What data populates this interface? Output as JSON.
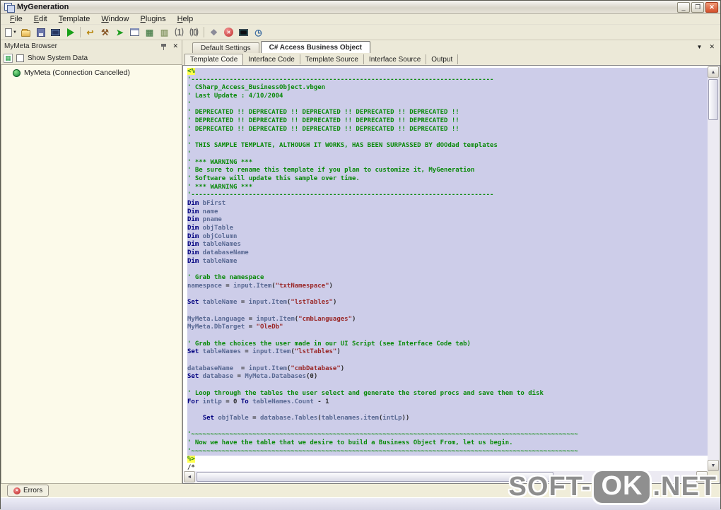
{
  "window": {
    "title": "MyGeneration"
  },
  "title_buttons": {
    "minimize": "_",
    "restore": "❐",
    "close": "✕"
  },
  "menu_bar": {
    "items": [
      "File",
      "Edit",
      "Template",
      "Window",
      "Plugins",
      "Help"
    ]
  },
  "toolbar": {
    "icons": [
      {
        "name": "new-file-icon",
        "kind": "page",
        "dropdown": true
      },
      {
        "name": "open-folder-icon",
        "kind": "folder"
      },
      {
        "name": "save-icon",
        "kind": "floppy"
      },
      {
        "name": "console-icon",
        "kind": "console"
      },
      {
        "name": "run-template-icon",
        "kind": "play"
      },
      {
        "name": "sep1",
        "kind": "sep"
      },
      {
        "name": "revert-icon",
        "kind": "glyph",
        "glyph": "↩",
        "color": "#b8860b"
      },
      {
        "name": "build-tools-icon",
        "kind": "glyph",
        "glyph": "⚒",
        "color": "#8a5a2a"
      },
      {
        "name": "execute-script-icon",
        "kind": "glyph",
        "glyph": "➤",
        "color": "#1f9e1f"
      },
      {
        "name": "form-designer-icon",
        "kind": "form"
      },
      {
        "name": "tile-horizontal-icon",
        "kind": "glyph",
        "glyph": "▦",
        "color": "#5a8a5a"
      },
      {
        "name": "tile-vertical-icon",
        "kind": "glyph",
        "glyph": "▥",
        "color": "#8a9a6a"
      },
      {
        "name": "info-1-icon",
        "kind": "glyph",
        "glyph": "⑴",
        "color": "#666"
      },
      {
        "name": "info-0-icon",
        "kind": "glyph",
        "glyph": "⑽",
        "color": "#666"
      },
      {
        "name": "sep2",
        "kind": "sep"
      },
      {
        "name": "plugin-icon",
        "kind": "glyph",
        "glyph": "❖",
        "color": "#8a8a98"
      },
      {
        "name": "stop-icon",
        "kind": "circle-x",
        "glyph": "✕"
      },
      {
        "name": "monitor-icon",
        "kind": "monitor-dark"
      },
      {
        "name": "clock-icon",
        "kind": "glyph",
        "glyph": "◷",
        "color": "#3a6aa0"
      }
    ]
  },
  "sidebar": {
    "title": "MyMeta Browser",
    "show_system_data_label": "Show System Data",
    "tree": [
      {
        "label": "MyMeta (Connection Cancelled)"
      }
    ]
  },
  "document_tabs": [
    {
      "label": "Default Settings",
      "active": false
    },
    {
      "label": "C# Access Business Object",
      "active": true
    }
  ],
  "editor_tabs": [
    {
      "label": "Template Code",
      "active": true
    },
    {
      "label": "Interface Code",
      "active": false
    },
    {
      "label": "Template Source",
      "active": false
    },
    {
      "label": "Interface Source",
      "active": false
    },
    {
      "label": "Output",
      "active": false
    }
  ],
  "errors_panel": {
    "label": "Errors"
  },
  "watermark": {
    "left": "SOFT-",
    "ok": "OK",
    "right": ".NET"
  },
  "colors": {
    "selection_bg": "#cdcde9",
    "comment": "#0a8a0a",
    "keyword": "#00007f",
    "string": "#9a2828",
    "script_tag_bg": "#ffff4e",
    "close_button": "#d4502b",
    "error_red": "#bb2a2a"
  },
  "editor": {
    "selected_count": 47,
    "lines": [
      [
        [
          "tag",
          "<%"
        ]
      ],
      [
        [
          "cm",
          "'-------------------------------------------------------------------------------"
        ]
      ],
      [
        [
          "cm",
          "' CSharp_Access_BusinessObject.vbgen"
        ]
      ],
      [
        [
          "cm",
          "' Last Update : 4/10/2004"
        ]
      ],
      [
        [
          "cm",
          "'"
        ]
      ],
      [
        [
          "cm",
          "' DEPRECATED !! DEPRECATED !! DEPRECATED !! DEPRECATED !! DEPRECATED !!"
        ]
      ],
      [
        [
          "cm",
          "' DEPRECATED !! DEPRECATED !! DEPRECATED !! DEPRECATED !! DEPRECATED !!"
        ]
      ],
      [
        [
          "cm",
          "' DEPRECATED !! DEPRECATED !! DEPRECATED !! DEPRECATED !! DEPRECATED !!"
        ]
      ],
      [
        [
          "cm",
          "'"
        ]
      ],
      [
        [
          "cm",
          "' THIS SAMPLE TEMPLATE, ALTHOUGH IT WORKS, HAS BEEN SURPASSED BY dOOdad templates"
        ]
      ],
      [
        [
          "cm",
          "'"
        ]
      ],
      [
        [
          "cm",
          "' *** WARNING ***"
        ]
      ],
      [
        [
          "cm",
          "' Be sure to rename this template if you plan to customize it, MyGeneration"
        ]
      ],
      [
        [
          "cm",
          "' Software will update this sample over time."
        ]
      ],
      [
        [
          "cm",
          "' *** WARNING ***"
        ]
      ],
      [
        [
          "cm",
          "'-------------------------------------------------------------------------------"
        ]
      ],
      [
        [
          "kw",
          "Dim"
        ],
        [
          "idn",
          " bFirst"
        ]
      ],
      [
        [
          "kw",
          "Dim"
        ],
        [
          "idn",
          " name"
        ]
      ],
      [
        [
          "kw",
          "Dim"
        ],
        [
          "idn",
          " pname"
        ]
      ],
      [
        [
          "kw",
          "Dim"
        ],
        [
          "idn",
          " objTable"
        ]
      ],
      [
        [
          "kw",
          "Dim"
        ],
        [
          "idn",
          " objColumn"
        ]
      ],
      [
        [
          "kw",
          "Dim"
        ],
        [
          "idn",
          " tableNames"
        ]
      ],
      [
        [
          "kw",
          "Dim"
        ],
        [
          "idn",
          " databaseName"
        ]
      ],
      [
        [
          "kw",
          "Dim"
        ],
        [
          "idn",
          " tableName"
        ]
      ],
      [],
      [
        [
          "cm",
          "' Grab the namespace"
        ]
      ],
      [
        [
          "idn",
          "namespace"
        ],
        [
          "pl",
          " = "
        ],
        [
          "idn",
          "input.Item"
        ],
        [
          "pl",
          "("
        ],
        [
          "str",
          "\"txtNamespace\""
        ],
        [
          "pl",
          ")"
        ]
      ],
      [],
      [
        [
          "kw",
          "Set"
        ],
        [
          "idn",
          " tableName"
        ],
        [
          "pl",
          " = "
        ],
        [
          "idn",
          "input.Item"
        ],
        [
          "pl",
          "("
        ],
        [
          "str",
          "\"lstTables\""
        ],
        [
          "pl",
          ")"
        ]
      ],
      [],
      [
        [
          "idn",
          "MyMeta.Language"
        ],
        [
          "pl",
          " = "
        ],
        [
          "idn",
          "input.Item"
        ],
        [
          "pl",
          "("
        ],
        [
          "str",
          "\"cmbLanguages\""
        ],
        [
          "pl",
          ")"
        ]
      ],
      [
        [
          "idn",
          "MyMeta.DbTarget"
        ],
        [
          "pl",
          " = "
        ],
        [
          "str",
          "\"OleDb\""
        ]
      ],
      [],
      [
        [
          "cm",
          "' Grab the choices the user made in our UI Script (see Interface Code tab)"
        ]
      ],
      [
        [
          "kw",
          "Set"
        ],
        [
          "idn",
          " tableNames"
        ],
        [
          "pl",
          " = "
        ],
        [
          "idn",
          "input.Item"
        ],
        [
          "pl",
          "("
        ],
        [
          "str",
          "\"lstTables\""
        ],
        [
          "pl",
          ")"
        ]
      ],
      [],
      [
        [
          "idn",
          "databaseName"
        ],
        [
          "pl",
          "  = "
        ],
        [
          "idn",
          "input.Item"
        ],
        [
          "pl",
          "("
        ],
        [
          "str",
          "\"cmbDatabase\""
        ],
        [
          "pl",
          ")"
        ]
      ],
      [
        [
          "kw",
          "Set"
        ],
        [
          "idn",
          " database"
        ],
        [
          "pl",
          " = "
        ],
        [
          "idn",
          "MyMeta.Databases"
        ],
        [
          "pl",
          "(0)"
        ]
      ],
      [],
      [
        [
          "cm",
          "' Loop through the tables the user select and generate the stored procs and save them to disk"
        ]
      ],
      [
        [
          "kw",
          "For"
        ],
        [
          "idn",
          " intLp"
        ],
        [
          "pl",
          " = 0 "
        ],
        [
          "kw",
          "To"
        ],
        [
          "idn",
          " tableNames.Count"
        ],
        [
          "pl",
          " - 1"
        ]
      ],
      [],
      [
        [
          "pl",
          "    "
        ],
        [
          "kw",
          "Set"
        ],
        [
          "idn",
          " objTable"
        ],
        [
          "pl",
          " = "
        ],
        [
          "idn",
          "database.Tables"
        ],
        [
          "pl",
          "("
        ],
        [
          "idn",
          "tablenames.item"
        ],
        [
          "pl",
          "("
        ],
        [
          "idn",
          "intLp"
        ],
        [
          "pl",
          "))"
        ]
      ],
      [],
      [
        [
          "cm",
          "'~~~~~~~~~~~~~~~~~~~~~~~~~~~~~~~~~~~~~~~~~~~~~~~~~~~~~~~~~~~~~~~~~~~~~~~~~~~~~~~~~~~~~~~~~~~~~~~~~~~~~"
        ]
      ],
      [
        [
          "cm",
          "' Now we have the table that we desire to build a Business Object From, let us begin."
        ]
      ],
      [
        [
          "cm",
          "'~~~~~~~~~~~~~~~~~~~~~~~~~~~~~~~~~~~~~~~~~~~~~~~~~~~~~~~~~~~~~~~~~~~~~~~~~~~~~~~~~~~~~~~~~~~~~~~~~~~~~"
        ]
      ],
      [
        [
          "tag",
          "%>"
        ]
      ],
      [
        [
          "pl",
          "/*"
        ]
      ],
      [
        [
          "pl",
          "============================================================================"
        ]
      ]
    ]
  }
}
